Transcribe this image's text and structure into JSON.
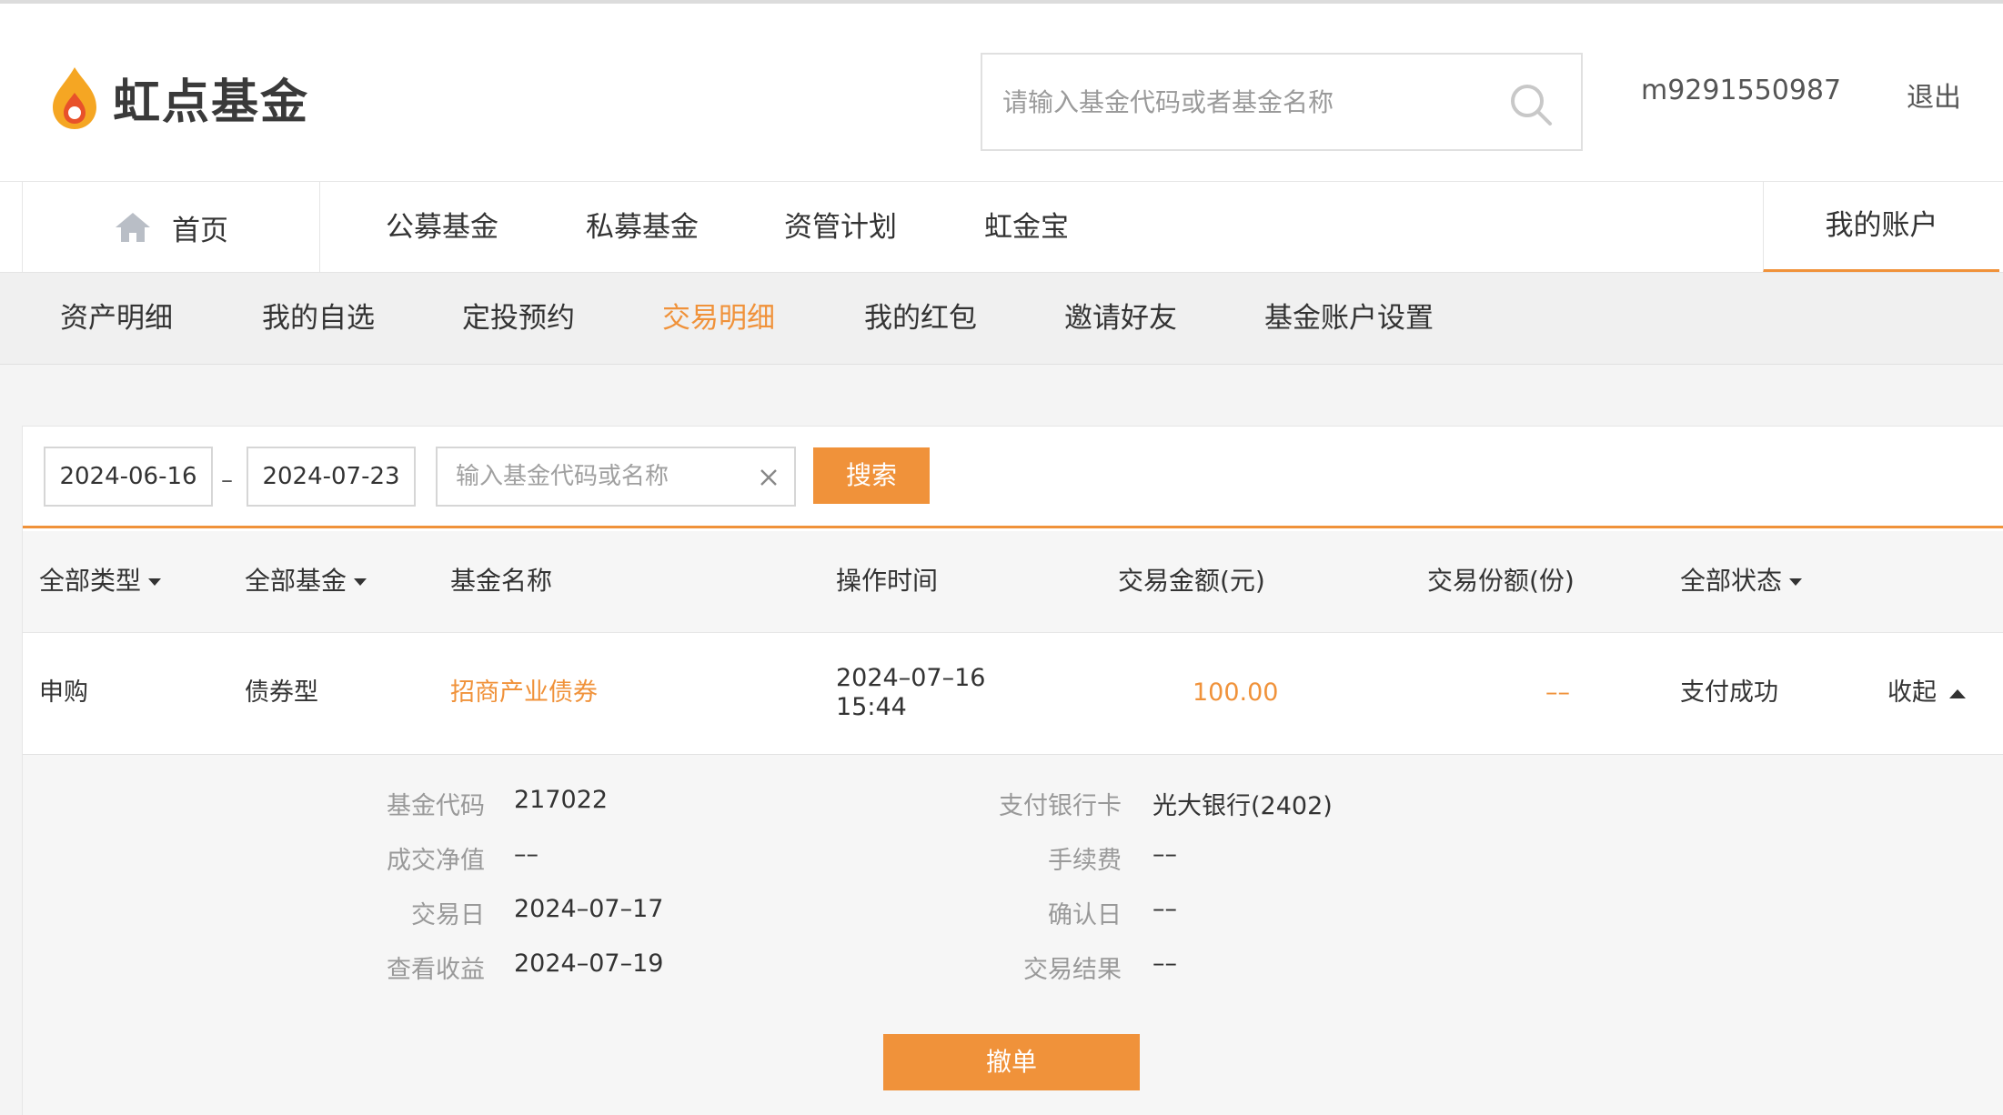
{
  "header": {
    "logo_text": "虹点基金",
    "search_placeholder": "请输入基金代码或者基金名称",
    "username": "m9291550987",
    "logout": "退出"
  },
  "main_nav": {
    "home": "首页",
    "items": [
      "公募基金",
      "私募基金",
      "资管计划",
      "虹金宝"
    ],
    "account": "我的账户"
  },
  "sub_nav": {
    "items": [
      "资产明细",
      "我的自选",
      "定投预约",
      "交易明细",
      "我的红包",
      "邀请好友",
      "基金账户设置"
    ],
    "active": "交易明细"
  },
  "filter": {
    "start_date": "2024-06-16",
    "separator": "–",
    "end_date": "2024-07-23",
    "fund_placeholder": "输入基金代码或名称",
    "search_button": "搜索"
  },
  "table": {
    "headers": {
      "type": "全部类型",
      "fund": "全部基金",
      "name": "基金名称",
      "time": "操作时间",
      "amount": "交易金额(元)",
      "shares": "交易份额(份)",
      "status": "全部状态"
    },
    "rows": [
      {
        "type": "申购",
        "fund_type": "债券型",
        "name": "招商产业债券",
        "date": "2024–07–16",
        "time": "15:44",
        "amount": "100.00",
        "shares": "––",
        "status": "支付成功",
        "toggle": "收起"
      }
    ]
  },
  "detail": {
    "left": [
      {
        "label": "基金代码",
        "value": "217022"
      },
      {
        "label": "成交净值",
        "value": "––"
      },
      {
        "label": "交易日",
        "value": "2024–07–17"
      },
      {
        "label": "查看收益",
        "value": "2024–07–19"
      }
    ],
    "right": [
      {
        "label": "支付银行卡",
        "value": "光大银行(2402)"
      },
      {
        "label": "手续费",
        "value": "––"
      },
      {
        "label": "确认日",
        "value": "––"
      },
      {
        "label": "交易结果",
        "value": "––"
      }
    ],
    "cancel_button": "撤单"
  },
  "colors": {
    "accent": "#f0923a",
    "text": "#333333",
    "muted": "#999999"
  }
}
